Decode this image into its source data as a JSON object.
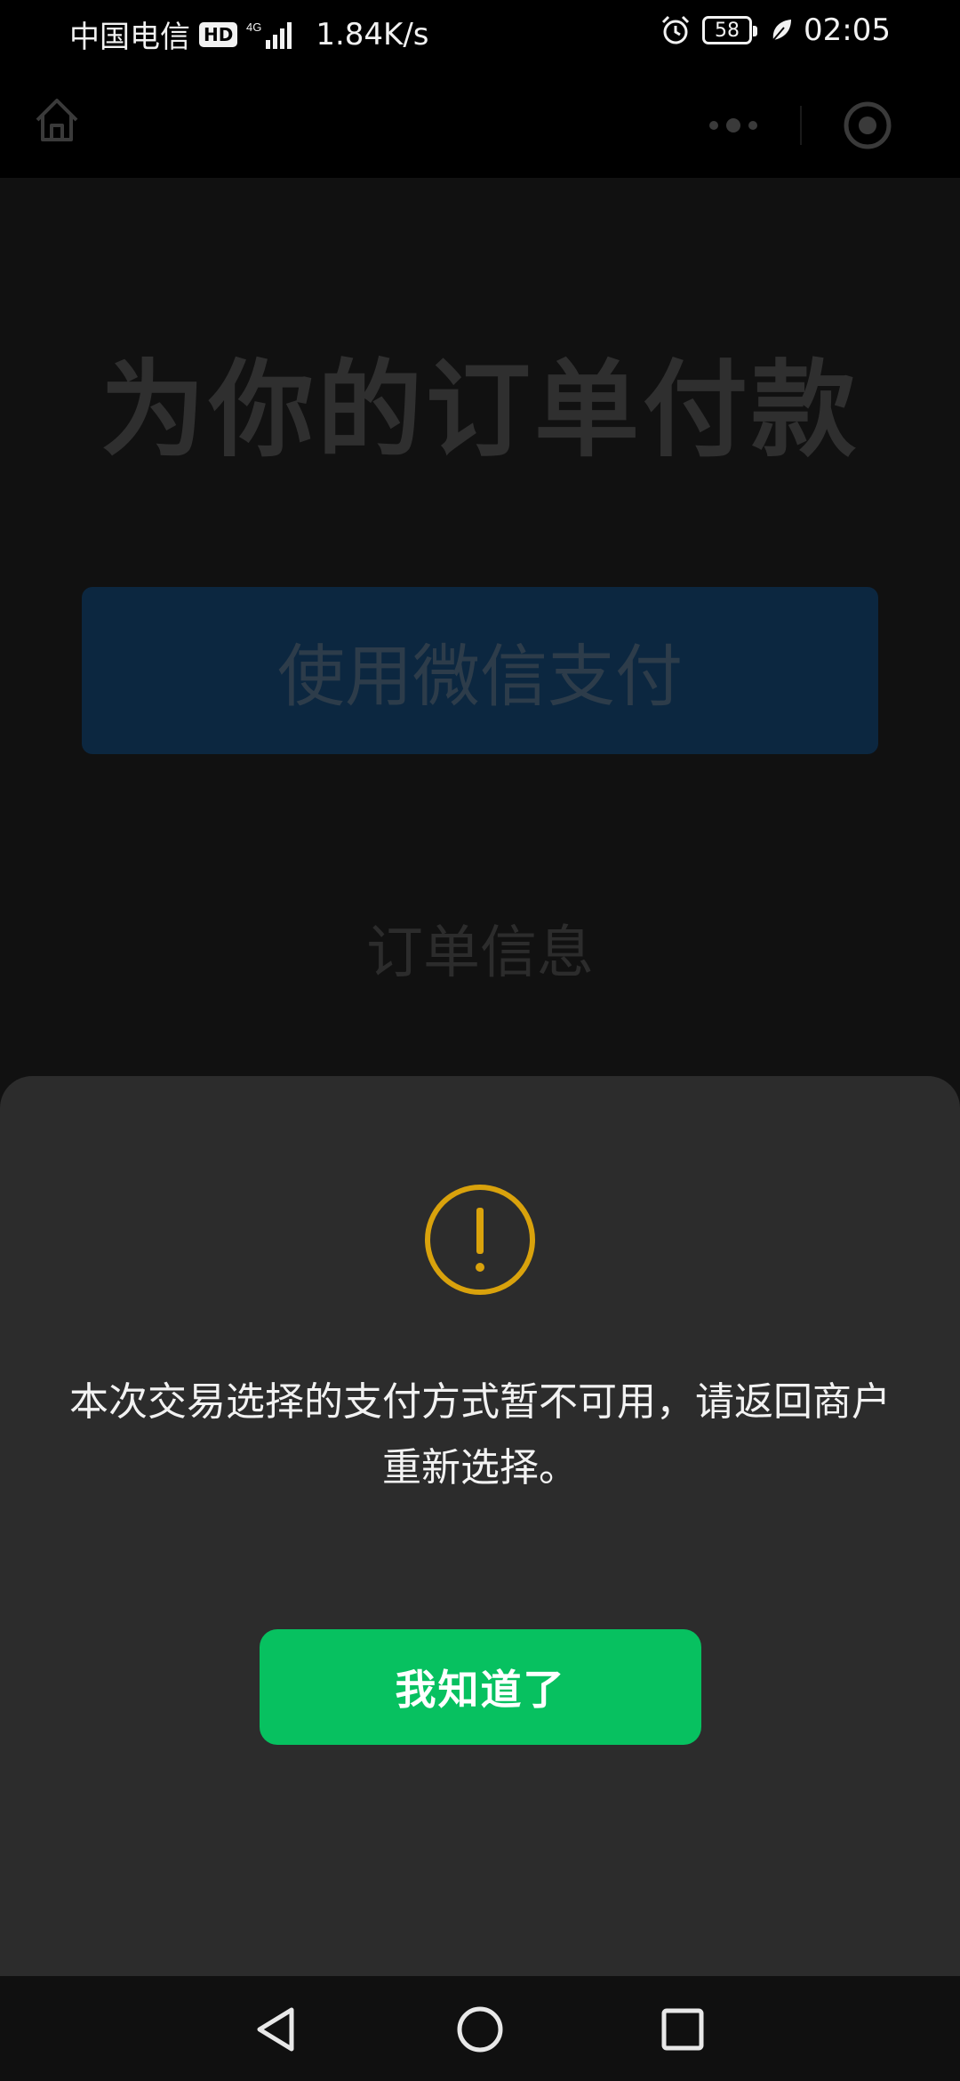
{
  "status_bar": {
    "carrier": "中国电信",
    "hd": "HD",
    "net_speed": "1.84K/s",
    "battery": "58",
    "time": "02:05"
  },
  "icons": {
    "home": "home-icon",
    "more": "more-dots-icon",
    "close": "target-close-icon",
    "warning": "warning-circle-icon",
    "back": "back-triangle-icon",
    "nav_home": "home-circle-icon",
    "recent": "recent-square-icon"
  },
  "page": {
    "title": "为你的订单付款",
    "pay_button_label": "使用微信支付",
    "order_info_label": "订单信息"
  },
  "dialog": {
    "message": "本次交易选择的支付方式暂不可用，请返回商户重新选择。",
    "confirm_label": "我知道了"
  },
  "colors": {
    "accent_green": "#07c160",
    "warning_yellow": "#d9a20c",
    "sheet_bg": "#2c2c2c"
  }
}
